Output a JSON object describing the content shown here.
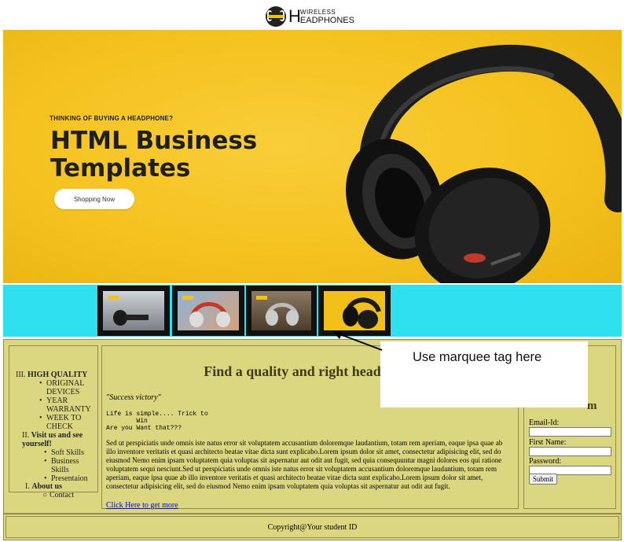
{
  "logo": {
    "big_letter": "H",
    "line1": "WIRELESS",
    "line2": "EADPHONES"
  },
  "hero": {
    "tagline": "THINKING OF BUYING A HEADPHONE?",
    "title_line1": "HTML Business",
    "title_line2": "Templates",
    "button_label": "Shopping Now"
  },
  "colors": {
    "hero_bg": "#f5c21f",
    "strip_bg": "#2fe1ef",
    "panel_bg": "#dbd780",
    "border": "#8f8b52",
    "link": "#0000ee"
  },
  "nav": {
    "sections": [
      {
        "marker": "III.",
        "title": "HIGH QUALITY",
        "bullet": "•",
        "items": [
          "ORIGINAL DEVICES",
          "YEAR WARRANTY",
          "WEEK TO CHECK"
        ]
      },
      {
        "marker": "II.",
        "title": "Visit us and see yourself!",
        "bullet": "•",
        "items": [
          "Soft Skills",
          "Business Skills",
          "Presentaion"
        ]
      },
      {
        "marker": "I.",
        "title": "About us",
        "bullet": "○",
        "items": [
          "Contact"
        ]
      }
    ]
  },
  "main": {
    "title": "Find a quality and right headphone",
    "quote": "\"Success victory\"",
    "pre_text": "Life is simple.... Trick to\n        Win\nAre you Want that???",
    "paragraph": "Sed ut perspiciatis unde omnis iste natus error sit voluptatem accusantium doloremque laudantium, totam rem aperiam, eaque ipsa quae ab illo inventore veritatis et quasi architecto beatae vitae dicta sunt explicabo.Lorem ipsum dolor sit amet, consectetur adipisicing elit, sed do eiusmod Nemo enim ipsam voluptatem quia voluptas sit aspernatur aut odit aut fugit, sed quia consequuntur magni dolores eos qui ratione voluptatem sequi nesciunt.Sed ut perspiciatis unde omnis iste natus error sit voluptatem accusantium doloremque laudantium, totam rem aperiam, eaque ipsa quae ab illo inventore veritatis et quasi architecto beatae vitae dicta sunt explicabo.Lorem ipsum dolor sit amet, consectetur adipisicing elit, sed do eiusmod Nemo enim ipsam voluptatem quia voluptas sit aspernatur aut odit aut fugit.",
    "link": "Click Here to get more"
  },
  "form": {
    "heading_visible": "m",
    "email_label": "Email-Id:",
    "first_name_label": "First Name:",
    "password_label": "Password:",
    "email_value": "",
    "first_name_value": "",
    "password_value": "",
    "submit_label": "Submit"
  },
  "footer": {
    "text": "Copyright@Your student ID"
  },
  "annotation": {
    "text": "Use marquee tag here"
  },
  "thumbnails": [
    {
      "icon": "headphone-photo-icon",
      "tone": "#7a7f86"
    },
    {
      "icon": "headphone-photo-icon",
      "tone": "#4a7fb8"
    },
    {
      "icon": "headphone-photo-icon",
      "tone": "#6e5a44"
    },
    {
      "icon": "headphone-photo-icon",
      "tone": "#f3c01a"
    }
  ]
}
